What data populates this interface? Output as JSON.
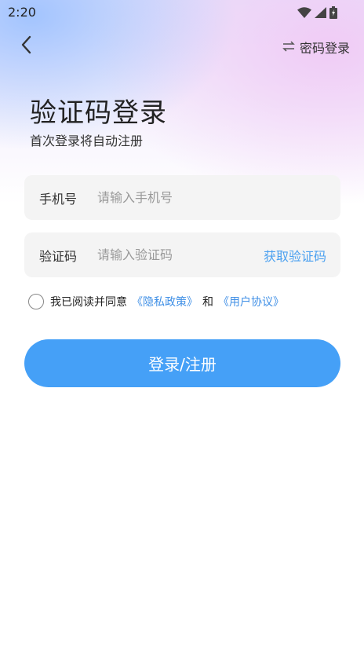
{
  "status_bar": {
    "time": "2:20"
  },
  "nav": {
    "password_login_label": "密码登录"
  },
  "header": {
    "title": "验证码登录",
    "subtitle": "首次登录将自动注册"
  },
  "form": {
    "phone": {
      "label": "手机号",
      "placeholder": "请输入手机号"
    },
    "code": {
      "label": "验证码",
      "placeholder": "请输入验证码",
      "get_code_label": "获取验证码"
    }
  },
  "agreement": {
    "prefix": "我已阅读并同意",
    "privacy_link": "《隐私政策》",
    "conjunction": "和",
    "user_link": "《用户协议》"
  },
  "submit": {
    "label": "登录/注册"
  },
  "colors": {
    "accent": "#45a0f7",
    "link": "#3f8fe6"
  }
}
